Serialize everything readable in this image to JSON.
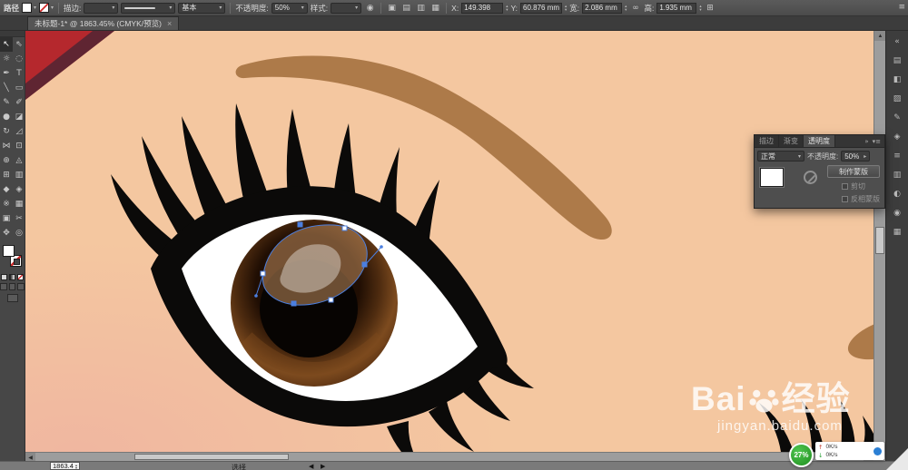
{
  "colors": {
    "skin": "#f4c7a0",
    "brow": "#ad7a49",
    "red_a": "#b5282d",
    "red_b": "#5f2532",
    "blue": "#4b7fe0",
    "green": "#2ba82b"
  },
  "topbar": {
    "context_label": "路径",
    "stroke_label": "描边:",
    "brush_value": "基本",
    "opacity_label": "不透明度:",
    "opacity_value": "50%",
    "style_label": "样式:",
    "x_label": "X:",
    "x_value": "149.398",
    "y_label": "Y:",
    "y_value": "60.876 mm",
    "w_label": "宽:",
    "w_value": "2.086 mm",
    "h_label": "高:",
    "h_value": "1.935 mm",
    "icons": {
      "recolor": "◉",
      "setup": "▣",
      "align_a": "▤",
      "align_b": "▥",
      "align_c": "▦",
      "link": "∞",
      "transform": "⊞",
      "menu": "≡"
    }
  },
  "tab": {
    "title": "未标题-1* @ 1863.45% (CMYK/预览)",
    "close_glyph": "×"
  },
  "tools": [
    {
      "name": "selection-tool",
      "glyph": "↖"
    },
    {
      "name": "direct-selection-tool",
      "glyph": "⇖"
    },
    {
      "name": "magic-wand-tool",
      "glyph": "☼"
    },
    {
      "name": "lasso-tool",
      "glyph": "◌"
    },
    {
      "name": "pen-tool",
      "glyph": "✒"
    },
    {
      "name": "type-tool",
      "glyph": "T"
    },
    {
      "name": "line-segment-tool",
      "glyph": "╲"
    },
    {
      "name": "rectangle-tool",
      "glyph": "▭"
    },
    {
      "name": "paintbrush-tool",
      "glyph": "✎"
    },
    {
      "name": "pencil-tool",
      "glyph": "✐"
    },
    {
      "name": "blob-brush-tool",
      "glyph": "●"
    },
    {
      "name": "eraser-tool",
      "glyph": "◪"
    },
    {
      "name": "rotate-tool",
      "glyph": "↻"
    },
    {
      "name": "scale-tool",
      "glyph": "◿"
    },
    {
      "name": "width-tool",
      "glyph": "⋈"
    },
    {
      "name": "free-transform-tool",
      "glyph": "⊡"
    },
    {
      "name": "shape-builder-tool",
      "glyph": "⊕"
    },
    {
      "name": "perspective-grid-tool",
      "glyph": "◬"
    },
    {
      "name": "mesh-tool",
      "glyph": "⊞"
    },
    {
      "name": "gradient-tool",
      "glyph": "▥"
    },
    {
      "name": "eyedropper-tool",
      "glyph": "◆"
    },
    {
      "name": "blend-tool",
      "glyph": "◈"
    },
    {
      "name": "symbol-sprayer-tool",
      "glyph": "※"
    },
    {
      "name": "column-graph-tool",
      "glyph": "▦"
    },
    {
      "name": "artboard-tool",
      "glyph": "▣"
    },
    {
      "name": "slice-tool",
      "glyph": "✂"
    },
    {
      "name": "hand-tool",
      "glyph": "✥"
    },
    {
      "name": "zoom-tool",
      "glyph": "◎"
    }
  ],
  "transparency_panel": {
    "tabs": [
      "描边",
      "渐变",
      "透明度"
    ],
    "blend_mode": "正常",
    "opacity_label": "不透明度:",
    "opacity_value": "50%",
    "make_mask_label": "制作蒙版",
    "clip_label": "剪切",
    "invert_label": "反相蒙版",
    "expand_glyph": "»",
    "menu_glyph": "▾≡"
  },
  "dock_icons": [
    {
      "name": "expand-panels-icon",
      "glyph": "«"
    },
    {
      "name": "color-panel-icon",
      "glyph": "▤"
    },
    {
      "name": "color-guide-panel-icon",
      "glyph": "◧"
    },
    {
      "name": "swatches-panel-icon",
      "glyph": "▨"
    },
    {
      "name": "brushes-panel-icon",
      "glyph": "✎"
    },
    {
      "name": "symbols-panel-icon",
      "glyph": "◈"
    },
    {
      "name": "stroke-panel-icon",
      "glyph": "≡"
    },
    {
      "name": "gradient-panel-icon",
      "glyph": "▥"
    },
    {
      "name": "transparency-panel-icon",
      "glyph": "◐"
    },
    {
      "name": "appearance-panel-icon",
      "glyph": "◉"
    },
    {
      "name": "layers-panel-icon",
      "glyph": "▦"
    }
  ],
  "statusbar": {
    "zoom_value": "1863.4",
    "tool_label": "选择"
  },
  "watermark": {
    "brand_prefix": "Bai",
    "brand_suffix": "经验",
    "url": "jingyan.baidu.com"
  },
  "net_widget": {
    "percent": "27%",
    "rows": [
      {
        "icon": "↑",
        "value": "0K/s"
      },
      {
        "icon": "↓",
        "value": "0K/s"
      }
    ]
  }
}
